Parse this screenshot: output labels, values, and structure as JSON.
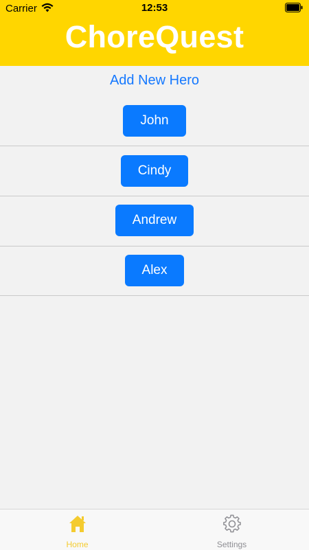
{
  "status_bar": {
    "carrier": "Carrier",
    "time": "12:53"
  },
  "header": {
    "title": "ChoreQuest",
    "background_color": "#FFD600"
  },
  "main": {
    "add_hero_label": "Add New Hero",
    "heroes": [
      {
        "name": "John"
      },
      {
        "name": "Cindy"
      },
      {
        "name": "Andrew"
      },
      {
        "name": "Alex"
      }
    ]
  },
  "tab_bar": {
    "items": [
      {
        "label": "Home",
        "icon": "house-icon",
        "active": true,
        "color": "#F4CB2F"
      },
      {
        "label": "Settings",
        "icon": "gear-icon",
        "active": false,
        "color": "#8E8E93"
      }
    ]
  },
  "colors": {
    "accent": "#0A7AFF",
    "link": "#1478FF",
    "background": "#F2F2F2"
  }
}
